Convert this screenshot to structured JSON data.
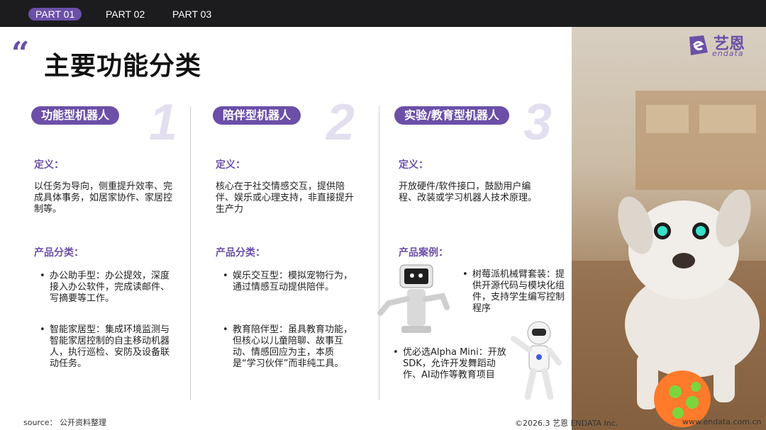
{
  "nav": {
    "tabs": [
      "PART 01",
      "PART 02",
      "PART 03"
    ]
  },
  "logo": {
    "cn": "艺恩",
    "en": "endata"
  },
  "title": "主要功能分类",
  "columns": [
    {
      "label": "功能型机器人",
      "number": "1",
      "def_heading": "定义：",
      "definition": "以任务为导向，侧重提升效率、完成具体事务，如居家协作、家居控制等。",
      "list_heading": "产品分类：",
      "items": [
        "办公助手型：办公提效，深度接入办公软件，完成读邮件、写摘要等工作。",
        "智能家居型：集成环境监测与智能家居控制的自主移动机器人，执行巡检、安防及设备联动任务。"
      ]
    },
    {
      "label": "陪伴型机器人",
      "number": "2",
      "def_heading": "定义：",
      "definition": "核心在于社交情感交互，提供陪伴、娱乐或心理支持，非直接提升生产力",
      "list_heading": "产品分类：",
      "items": [
        "娱乐交互型：模拟宠物行为，通过情感互动提供陪伴。",
        "教育陪伴型：虽具教育功能，但核心以儿童陪聊、故事互动、情感回应为主，本质是“学习伙伴”而非纯工具。"
      ]
    },
    {
      "label": "实验/教育型机器人",
      "number": "3",
      "def_heading": "定义：",
      "definition": "开放硬件/软件接口，鼓励用户编程、改装或学习机器人技术原理。",
      "list_heading": "产品案例：",
      "items": [
        "树莓派机械臂套装：提供开源代码与模块化组件，支持学生编写控制程序",
        "优必选Alpha Mini：开放SDK，允许开发舞蹈动作、AI动作等教育项目"
      ]
    }
  ],
  "footer": {
    "source": "source： 公开资料整理",
    "copyright": "©2026.3  艺恩 ENDATA Inc.",
    "url": "www.endata.com.cn"
  },
  "colors": {
    "accent": "#6b4fa8",
    "topbar": "#1c1c1e",
    "number": "#e4dff0"
  }
}
